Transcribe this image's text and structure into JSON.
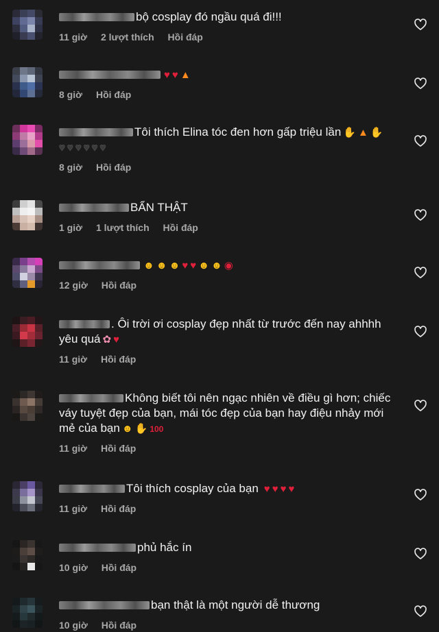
{
  "comments": [
    {
      "text": "bộ cosplay đó ngầu quá đi!!!",
      "time": "11 giờ",
      "likes": "2 lượt thích",
      "reply": "Hồi đáp",
      "emoji": []
    },
    {
      "text": "",
      "time": "8 giờ",
      "likes": "",
      "reply": "Hồi đáp",
      "emoji": [
        "red-heart",
        "red-heart",
        "fire"
      ]
    },
    {
      "text": "Tôi thích Elina tóc đen hơn gấp triệu lần",
      "time": "8 giờ",
      "likes": "",
      "reply": "Hồi đáp",
      "emoji": [
        "clapping-hands",
        "fire",
        "raising-hands",
        "black-heart",
        "black-heart",
        "black-heart",
        "black-heart",
        "black-heart",
        "black-heart"
      ]
    },
    {
      "text": "BẨN THẬT",
      "time": "1 giờ",
      "likes": "1 lượt thích",
      "reply": "Hồi đáp",
      "emoji": []
    },
    {
      "text": "",
      "time": "12 giờ",
      "likes": "",
      "reply": "Hồi đáp",
      "emoji": [
        "heart-eyes",
        "heart-eyes",
        "heart-eyes",
        "red-heart",
        "red-heart",
        "kissing-face",
        "kissing-face",
        "lips"
      ]
    },
    {
      "text": ". Ôi trời ơi cosplay đẹp nhất từ trước đến nay ahhhh yêu quá",
      "time": "11 giờ",
      "likes": "",
      "reply": "Hồi đáp",
      "emoji": [
        "cherry-blossom",
        "red-heart"
      ]
    },
    {
      "text": "Không biết tôi nên ngạc nhiên về điều gì hơn; chiếc váy tuyệt đẹp của bạn, mái tóc đẹp của bạn hay điệu nhảy mới mẻ của bạn",
      "time": "11 giờ",
      "likes": "",
      "reply": "Hồi đáp",
      "emoji": [
        "grinning-face",
        "ok-hand",
        "hundred-points"
      ]
    },
    {
      "text": "Tôi thích cosplay của bạn",
      "time": "11 giờ",
      "likes": "",
      "reply": "Hồi đáp",
      "emoji": [
        "red-heart",
        "red-heart",
        "red-heart",
        "red-heart"
      ]
    },
    {
      "text": "phủ hắc ín",
      "time": "10 giờ",
      "likes": "",
      "reply": "Hồi đáp",
      "emoji": []
    },
    {
      "text": "bạn thật là một người dễ thương",
      "time": "10 giờ",
      "likes": "",
      "reply": "Hồi đáp",
      "emoji": []
    }
  ],
  "colors": {
    "background": "#1a1a1a",
    "text": "#f2f2f2",
    "meta": "#a8a8a8",
    "heart_outline": "#e6e6e6"
  },
  "icons": {
    "like": "heart-outline-icon"
  }
}
